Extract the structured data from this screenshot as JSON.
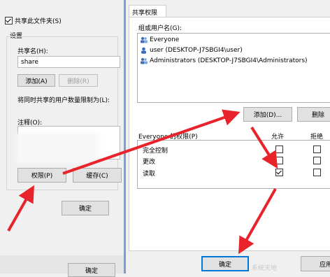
{
  "left_dialog": {
    "share_checkbox_label": "共享此文件夹(S)",
    "settings_group_label": "设置",
    "share_name_label": "共享名(H):",
    "share_name_value": "share",
    "add_button": "添加(A)",
    "remove_button": "删除(R)",
    "limit_users_label": "将同时共享的用户数量限制为(L):",
    "comment_label": "注释(O):",
    "permissions_button": "权限(P)",
    "cache_button": "缓存(C)",
    "ok_button": "确定",
    "bottom_ok_button": "确定"
  },
  "right_dialog": {
    "tab_label": "共享权限",
    "group_users_label": "组或用户名(G):",
    "users": [
      {
        "name": "Everyone"
      },
      {
        "name": "user (DESKTOP-J7SBGI4\\user)"
      },
      {
        "name": "Administrators (DESKTOP-J7SBGI4\\Administrators)"
      }
    ],
    "add_button": "添加(D)...",
    "remove_button": "删除",
    "permissions_header": "Everyone 的权限(P)",
    "allow_header": "允许",
    "deny_header": "拒绝",
    "permissions": [
      {
        "name": "完全控制",
        "allow": false,
        "deny": false
      },
      {
        "name": "更改",
        "allow": false,
        "deny": false
      },
      {
        "name": "读取",
        "allow": true,
        "deny": false
      }
    ],
    "ok_button": "确定",
    "apply_button": "应用"
  },
  "watermark": "系统天地",
  "colors": {
    "arrow": "#e8232b",
    "dialog_bg": "#f0f0f0",
    "divider": "#7a9fd6"
  }
}
